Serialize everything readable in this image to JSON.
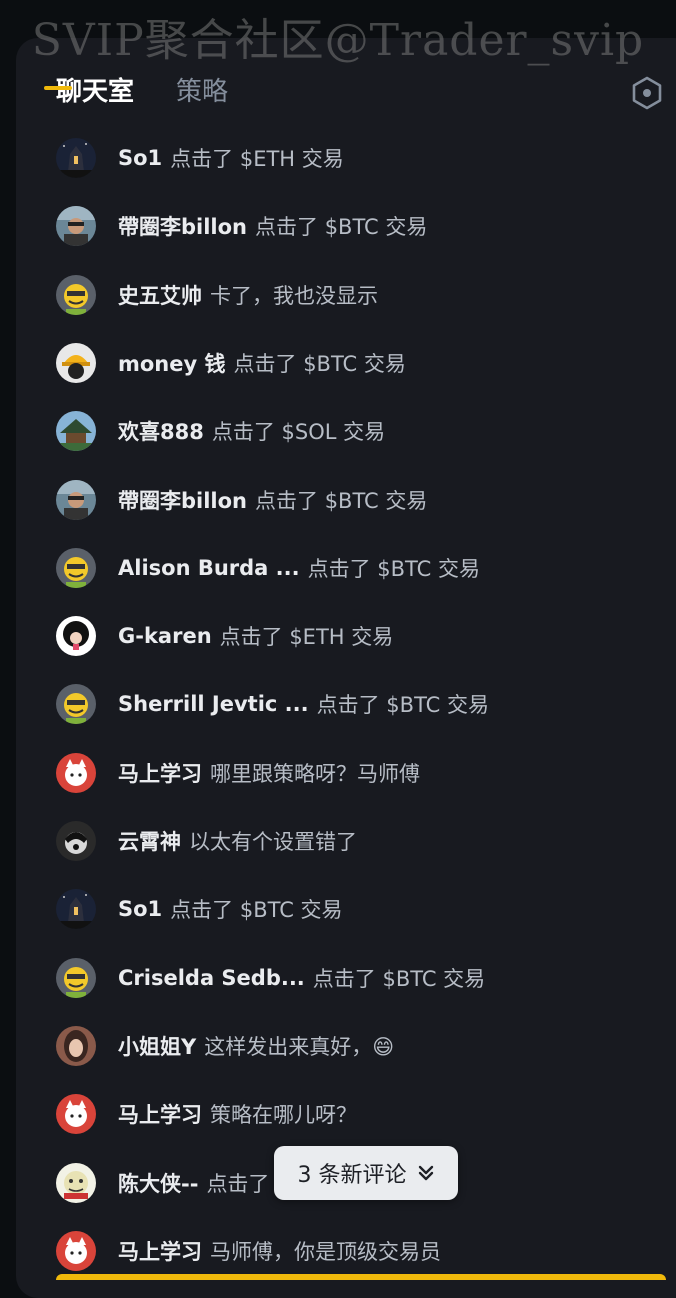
{
  "watermark": "SVIP聚合社区@Trader_svip",
  "tabs": [
    {
      "label": "聊天室",
      "active": true
    },
    {
      "label": "策略",
      "active": false
    }
  ],
  "settings_icon": "hexagon-settings-icon",
  "messages": [
    {
      "name": "So1",
      "text": "点击了 $ETH 交易",
      "avatar": "night-castle"
    },
    {
      "name": "帶圈李billon",
      "text": "点击了 $BTC 交易",
      "avatar": "car-selfie"
    },
    {
      "name": "史五艾帅",
      "text": "卡了，我也没显示",
      "avatar": "yellow-bot"
    },
    {
      "name": "money 钱",
      "text": "点击了 $BTC 交易",
      "avatar": "hardhat"
    },
    {
      "name": "欢喜888",
      "text": "点击了 $SOL 交易",
      "avatar": "temple"
    },
    {
      "name": "帶圈李billon",
      "text": "点击了 $BTC 交易",
      "avatar": "car-selfie"
    },
    {
      "name": "Alison Burda ...",
      "text": "点击了 $BTC 交易",
      "avatar": "yellow-bot"
    },
    {
      "name": "G-karen",
      "text": "点击了 $ETH 交易",
      "avatar": "black-white"
    },
    {
      "name": "Sherrill Jevtic ...",
      "text": "点击了 $BTC 交易",
      "avatar": "yellow-bot"
    },
    {
      "name": "马上学习",
      "text": "哪里跟策略呀？马师傅",
      "avatar": "red-cat"
    },
    {
      "name": "云霄神",
      "text": "以太有个设置错了",
      "avatar": "dark-fox"
    },
    {
      "name": "So1",
      "text": "点击了 $BTC 交易",
      "avatar": "night-castle"
    },
    {
      "name": "Criselda Sedb...",
      "text": "点击了 $BTC 交易",
      "avatar": "yellow-bot"
    },
    {
      "name": "小姐姐Y",
      "text": "这样发出来真好，😄",
      "avatar": "girl"
    },
    {
      "name": "马上学习",
      "text": "策略在哪儿呀？",
      "avatar": "red-cat"
    },
    {
      "name": "陈大侠--",
      "text": "点击了 $BTC 交易",
      "avatar": "cartoon"
    },
    {
      "name": "马上学习",
      "text": "马师傅，你是顶级交易员",
      "avatar": "red-cat"
    }
  ],
  "new_comments": {
    "label": "3 条新评论",
    "icon": "chevron-double-down-icon"
  },
  "colors": {
    "accent": "#f0b90b",
    "panel": "#181a20",
    "name": "#eaecef",
    "text": "#b7bdc6"
  }
}
